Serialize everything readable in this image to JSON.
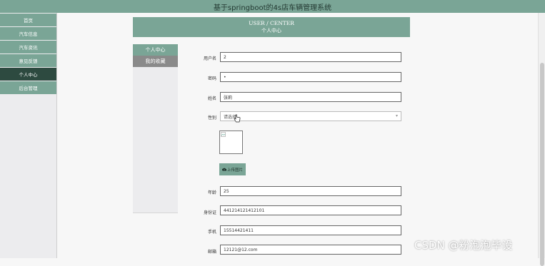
{
  "app": {
    "title": "基于springboot的4s店车辆管理系统"
  },
  "sidebar": {
    "items": [
      {
        "label": "首页"
      },
      {
        "label": "汽车信息"
      },
      {
        "label": "汽车资讯"
      },
      {
        "label": "意见反馈"
      },
      {
        "label": "个人中心"
      },
      {
        "label": "后台管理"
      }
    ],
    "active_index": 4
  },
  "page_header": {
    "title_en": "USER / CENTER",
    "title_zh": "个人中心"
  },
  "subnav": {
    "items": [
      {
        "label": "个人中心"
      },
      {
        "label": "我的收藏"
      }
    ]
  },
  "form": {
    "username": {
      "label": "用户名",
      "value": "2"
    },
    "password": {
      "label": "密码",
      "value": "•"
    },
    "name": {
      "label": "姓名",
      "value": "张莉"
    },
    "gender": {
      "label": "性别",
      "placeholder": "请选择"
    },
    "upload_button": {
      "label": "上传图片"
    },
    "age": {
      "label": "年龄",
      "value": "25"
    },
    "id_card": {
      "label": "身份证",
      "value": "441214121412101"
    },
    "phone": {
      "label": "手机",
      "value": "15514421411"
    },
    "email": {
      "label": "邮箱",
      "value": "12121@12.com"
    }
  },
  "watermark": {
    "text": "CSDN @粉泡泡毕设"
  },
  "colors": {
    "accent": "#7aa596",
    "active": "#2d4a40",
    "muted": "#8a8a8a"
  },
  "icons": {
    "upload": "cloud-upload-icon",
    "select_arrow": "chevron-down-icon",
    "broken_image": "broken-image-icon",
    "cursor": "hand-cursor-icon"
  }
}
